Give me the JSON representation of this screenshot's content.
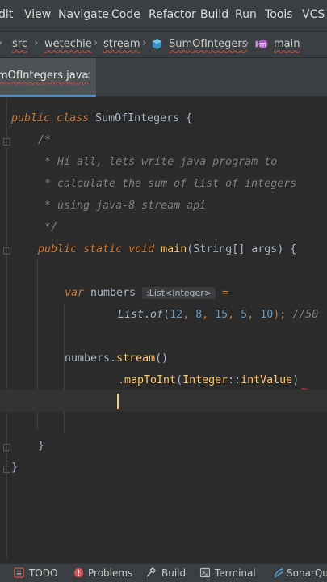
{
  "menu": [
    {
      "label": "dit",
      "accel": "d"
    },
    {
      "label": "View",
      "accel": "V"
    },
    {
      "label": "Navigate",
      "accel": "N"
    },
    {
      "label": "Code",
      "accel": "C"
    },
    {
      "label": "Refactor",
      "accel": "R"
    },
    {
      "label": "Build",
      "accel": "B"
    },
    {
      "label": "Run",
      "accel": "u"
    },
    {
      "label": "Tools",
      "accel": "T"
    },
    {
      "label": "VCS",
      "accel": "S"
    }
  ],
  "breadcrumb": [
    "src",
    "wetechie",
    "stream",
    "SumOfIntegers",
    "main"
  ],
  "tab": {
    "title": "mOfIntegers.java",
    "close": "×"
  },
  "code": {
    "l1": [
      "public",
      " ",
      "class",
      " SumOfIntegers {"
    ],
    "l2": "/*",
    "l3": " * Hi all, lets write java program to",
    "l4": " * calculate the sum of list of integers",
    "l5": " * using java-8 stream api",
    "l6": " */",
    "l7": [
      "public",
      " ",
      "static",
      " ",
      "void",
      " ",
      "main",
      "(String[] args) {"
    ],
    "l8": [
      "var",
      " numbers ",
      ":List<Integer>",
      " ="
    ],
    "l9": [
      "List",
      ".",
      "of",
      "(",
      "12",
      ", ",
      "8",
      ", ",
      "15",
      ", ",
      "5",
      ", ",
      "10",
      "); ",
      "//50"
    ],
    "l10": [
      "numbers",
      ".",
      "stream",
      "()"
    ],
    "l11": [
      ".",
      "mapToInt",
      "(",
      "Integer",
      "::",
      "intValue",
      ")"
    ],
    "l12": "}",
    "l13": "}"
  },
  "toolwindows": [
    {
      "label": "TODO",
      "icon": "todo-icon"
    },
    {
      "label": "Problems",
      "icon": "problems-icon"
    },
    {
      "label": "Build",
      "icon": "build-icon"
    },
    {
      "label": "Terminal",
      "icon": "terminal-icon"
    },
    {
      "label": "SonarQub",
      "icon": "sonarqube-icon"
    }
  ],
  "colors": {
    "keyword": "#cc7832",
    "method": "#ffc66d",
    "number": "#6897bb",
    "comment": "#629755",
    "background": "#2b2b2b",
    "accent": "#4a88c7"
  }
}
